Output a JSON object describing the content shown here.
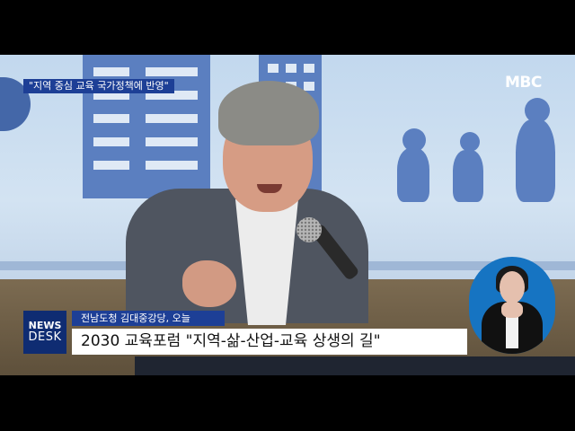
{
  "video": {
    "topic_tag": "\"지역 중심 교육 국가정책에 반영\"",
    "broadcaster_logo": "MBC"
  },
  "lower_third": {
    "program_line1": "NEWS",
    "program_line2": "DESK",
    "location": "전남도청 김대중강당, 오늘",
    "headline": "2030 교육포럼 \"지역-삶-산업-교육 상생의 길\""
  },
  "colors": {
    "accent_blue": "#1d3f96",
    "program_box": "#0f2c72",
    "sign_bubble": "#1674c2"
  }
}
